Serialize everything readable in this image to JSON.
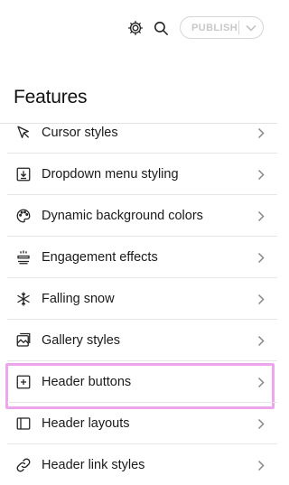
{
  "topbar": {
    "gear_icon": "gear-icon",
    "search_icon": "search-icon",
    "publish_label": "PUBLISH",
    "publish_chevron_icon": "chevron-down-icon"
  },
  "page": {
    "title": "Features"
  },
  "highlight_color": "#eca6ec",
  "features": [
    {
      "label": "Cursor styles",
      "icon": "cursor-icon"
    },
    {
      "label": "Dropdown menu styling",
      "icon": "dropdown-icon"
    },
    {
      "label": "Dynamic background colors",
      "icon": "palette-icon"
    },
    {
      "label": "Engagement effects",
      "icon": "sparkle-icon"
    },
    {
      "label": "Falling snow",
      "icon": "snowflake-icon"
    },
    {
      "label": "Gallery styles",
      "icon": "gallery-icon"
    },
    {
      "label": "Header buttons",
      "icon": "plus-square-icon",
      "highlighted": true
    },
    {
      "label": "Header layouts",
      "icon": "layout-icon"
    },
    {
      "label": "Header link styles",
      "icon": "link-icon"
    }
  ]
}
